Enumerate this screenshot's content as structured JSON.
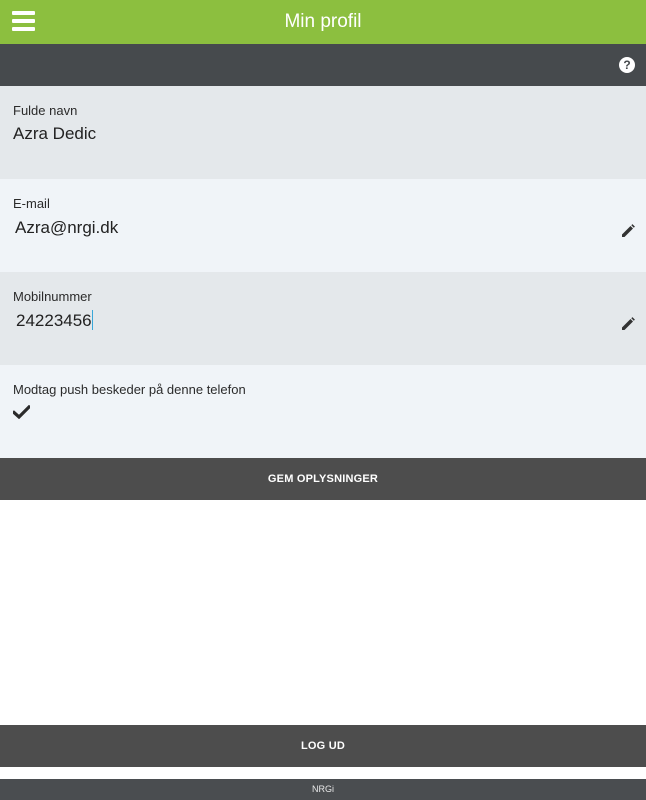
{
  "header": {
    "title": "Min profil",
    "menu_icon": "hamburger-menu-icon",
    "bg_color": "#8cbf3f"
  },
  "subbar": {
    "help_icon": "help-circle-icon",
    "help_glyph": "?"
  },
  "profile": {
    "name": {
      "label": "Fulde navn",
      "value": "Azra Dedic"
    },
    "email": {
      "label": "E-mail",
      "value": "Azra@nrgi.dk",
      "edit_icon": "pencil-icon"
    },
    "mobile": {
      "label": "Mobilnummer",
      "value": "24223456",
      "edit_icon": "pencil-icon"
    },
    "push": {
      "label": "Modtag push beskeder på denne telefon",
      "checked": true,
      "check_icon": "checkmark-icon"
    }
  },
  "actions": {
    "save_label": "GEM OPLYSNINGER",
    "logout_label": "LOG UD"
  },
  "footer": {
    "text": "NRGi"
  }
}
